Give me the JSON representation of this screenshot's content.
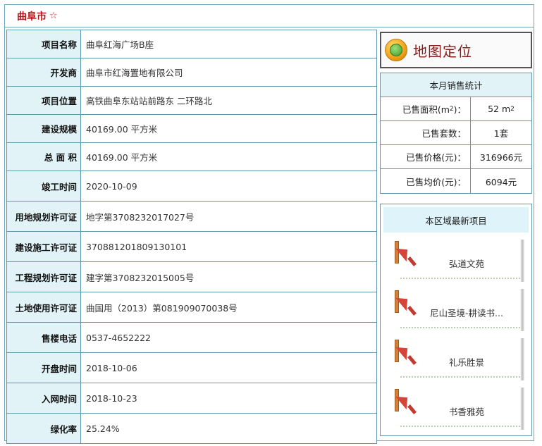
{
  "header": {
    "city": "曲阜市",
    "star": "☆"
  },
  "info_rows": [
    {
      "label": "项目名称",
      "value": "曲阜红海广场B座"
    },
    {
      "label": "开发商",
      "value": "曲阜市红海置地有限公司"
    },
    {
      "label": "项目位置",
      "value": "高铁曲阜东站站前路东 二环路北"
    },
    {
      "label": "建设规模",
      "value": "40169.00 平方米"
    },
    {
      "label": "总 面 积",
      "value": "40169.00 平方米"
    },
    {
      "label": "竣工时间",
      "value": "2020-10-09"
    },
    {
      "label": "用地规划许可证",
      "value": "地字第3708232017027号"
    },
    {
      "label": "建设施工许可证",
      "value": "370881201809130101"
    },
    {
      "label": "工程规划许可证",
      "value": "建字第3708232015005号"
    },
    {
      "label": "土地使用许可证",
      "value": "曲国用（2013）第081909070038号"
    },
    {
      "label": "售楼电话",
      "value": "0537-4652222"
    },
    {
      "label": "开盘时间",
      "value": "2018-10-06"
    },
    {
      "label": "入网时间",
      "value": "2018-10-23"
    },
    {
      "label": "绿化率",
      "value": "25.24%"
    }
  ],
  "map_button": {
    "label": "地图定位",
    "icon": "globe-icon"
  },
  "stats": {
    "title": "本月销售统计",
    "area_label_prefix": "已售面积(m",
    "area_label_sup": "2",
    "area_label_suffix": ")：",
    "area_value_num": "52 m",
    "area_value_sup": "2",
    "sets_label": "已售套数：",
    "sets_value": "1套",
    "price_label": "已售价格(元)：",
    "price_value": "316966元",
    "avg_label": "已售均价(元)：",
    "avg_value": "6094元"
  },
  "latest": {
    "title": "本区域最新项目",
    "projects": [
      {
        "name": "弘道文苑"
      },
      {
        "name": "尼山圣境-耕读书..."
      },
      {
        "name": "礼乐胜景"
      },
      {
        "name": "书香雅苑"
      }
    ]
  }
}
